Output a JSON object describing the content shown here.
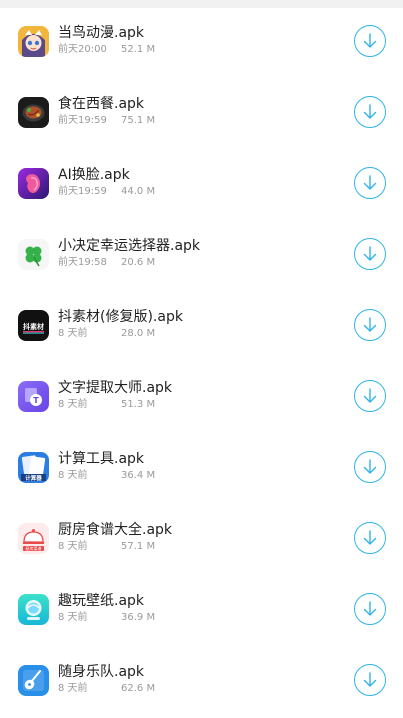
{
  "files": [
    {
      "name": "当鸟动漫.apk",
      "time": "前天20:00",
      "size": "52.1 M",
      "icon": "cartoon-girl-icon",
      "color": "#f0b43c"
    },
    {
      "name": "食在西餐.apk",
      "time": "前天19:59",
      "size": "75.1 M",
      "icon": "steak-dish-icon",
      "color": "#1e1e1e"
    },
    {
      "name": "AI换脸.apk",
      "time": "前天19:59",
      "size": "44.0 M",
      "icon": "face-swap-icon",
      "color": "#7a22d9"
    },
    {
      "name": "小决定幸运选择器.apk",
      "time": "前天19:58",
      "size": "20.6 M",
      "icon": "clover-icon",
      "color": "#35b34a"
    },
    {
      "name": "抖素材(修复版).apk",
      "time": "8 天前",
      "size": "28.0 M",
      "icon": "dou-material-icon",
      "color": "#111111"
    },
    {
      "name": "文字提取大师.apk",
      "time": "8 天前",
      "size": "51.3 M",
      "icon": "text-extract-icon",
      "color": "#7a5cf0"
    },
    {
      "name": "计算工具.apk",
      "time": "8 天前",
      "size": "36.4 M",
      "icon": "calculator-icon",
      "color": "#2a7de1"
    },
    {
      "name": "厨房食谱大全.apk",
      "time": "8 天前",
      "size": "57.1 M",
      "icon": "chef-bell-icon",
      "color": "#e94a4a"
    },
    {
      "name": "趣玩壁纸.apk",
      "time": "8 天前",
      "size": "36.9 M",
      "icon": "wallpaper-icon",
      "color": "#27cfc0"
    },
    {
      "name": "随身乐队.apk",
      "time": "8 天前",
      "size": "62.6 M",
      "icon": "guitar-icon",
      "color": "#2a8fe8"
    }
  ],
  "download_button_icon": "download-arrow-icon",
  "accent_color": "#2fb4ea",
  "icon_labels": {
    "dou": "抖素材",
    "calc": "计算器",
    "chef": "厨房菜谱"
  }
}
